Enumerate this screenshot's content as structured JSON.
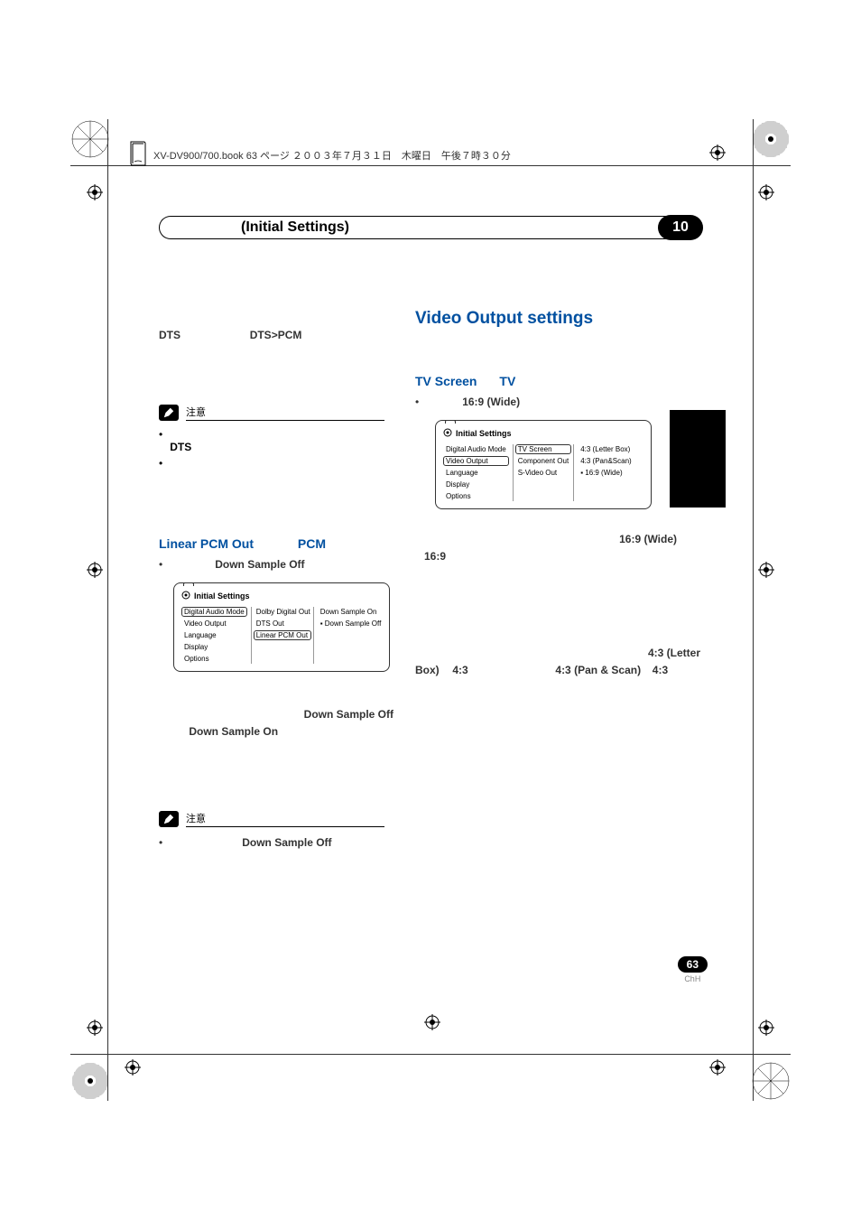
{
  "header": "XV-DV900/700.book 63 ページ ２００３年７月３１日　木曜日　午後７時３０分",
  "chapter": {
    "title": "(Initial Settings)",
    "number": "10"
  },
  "left": {
    "dts_label": "DTS",
    "dts_pcm": "DTS>PCM",
    "note_label": "注意",
    "note_dts": "DTS",
    "h_linear": "Linear PCM Out",
    "h_pcm": "PCM",
    "h_dso": "Down Sample Off",
    "osd_title": "Initial Settings",
    "osd_c1": [
      "Digital Audio Mode",
      "Video Output",
      "Language",
      "Display",
      "Options"
    ],
    "osd_c2": [
      "Dolby Digital Out",
      "DTS Out",
      "Linear PCM Out"
    ],
    "osd_c3": [
      "Down Sample On",
      "Down Sample Off"
    ],
    "p_dso": "Down Sample Off",
    "p_dson": "Down Sample On",
    "note2_dso": "Down Sample Off"
  },
  "right": {
    "h_video": "Video Output settings",
    "h_tvscreen": "TV Screen",
    "h_tv": "TV",
    "h_169": "16:9 (Wide)",
    "osd_title": "Initial Settings",
    "osd_c1": [
      "Digital Audio Mode",
      "Video Output",
      "Language",
      "Display",
      "Options"
    ],
    "osd_c2": [
      "TV Screen",
      "Component Out",
      "S-Video Out"
    ],
    "osd_c3": [
      "4:3 (Letter Box)",
      "4:3 (Pan&Scan)",
      "16:9 (Wide)"
    ],
    "p_169w": "16:9 (Wide)",
    "p_169": "16:9",
    "p_43lb": "4:3 (Letter",
    "p_box": "Box)",
    "p_43a": "4:3",
    "p_43ps": "4:3 (Pan & Scan)",
    "p_43b": "4:3"
  },
  "page": {
    "num": "63",
    "chh": "ChH"
  }
}
